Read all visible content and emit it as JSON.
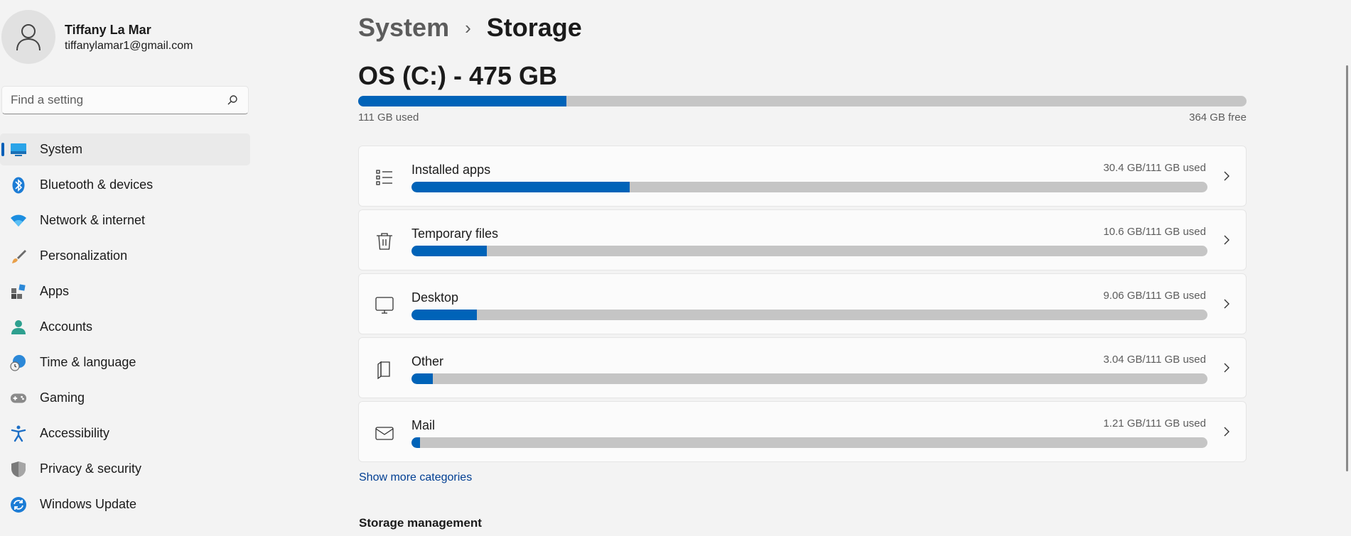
{
  "profile": {
    "name": "Tiffany La Mar",
    "email": "tiffanylamar1@gmail.com"
  },
  "search": {
    "placeholder": "Find a setting"
  },
  "sidebar": {
    "items": [
      {
        "label": "System",
        "icon": "system-icon",
        "active": true
      },
      {
        "label": "Bluetooth & devices",
        "icon": "bluetooth-icon"
      },
      {
        "label": "Network & internet",
        "icon": "wifi-icon"
      },
      {
        "label": "Personalization",
        "icon": "brush-icon"
      },
      {
        "label": "Apps",
        "icon": "apps-icon"
      },
      {
        "label": "Accounts",
        "icon": "account-icon"
      },
      {
        "label": "Time & language",
        "icon": "globe-clock-icon"
      },
      {
        "label": "Gaming",
        "icon": "gamepad-icon"
      },
      {
        "label": "Accessibility",
        "icon": "accessibility-icon"
      },
      {
        "label": "Privacy & security",
        "icon": "shield-icon"
      },
      {
        "label": "Windows Update",
        "icon": "update-icon"
      }
    ]
  },
  "breadcrumb": {
    "parent": "System",
    "separator": "›",
    "current": "Storage"
  },
  "drive": {
    "title": "OS (C:) - 475 GB",
    "used_label": "111 GB used",
    "free_label": "364 GB free",
    "used_fraction": 0.234
  },
  "categories": [
    {
      "label": "Installed apps",
      "usage": "30.4 GB/111 GB used",
      "fraction": 0.274,
      "icon": "list-icon"
    },
    {
      "label": "Temporary files",
      "usage": "10.6 GB/111 GB used",
      "fraction": 0.095,
      "icon": "trash-icon"
    },
    {
      "label": "Desktop",
      "usage": "9.06 GB/111 GB used",
      "fraction": 0.082,
      "icon": "monitor-icon"
    },
    {
      "label": "Other",
      "usage": "3.04 GB/111 GB used",
      "fraction": 0.027,
      "icon": "document-icon"
    },
    {
      "label": "Mail",
      "usage": "1.21 GB/111 GB used",
      "fraction": 0.011,
      "icon": "mail-icon"
    }
  ],
  "show_more_label": "Show more categories",
  "storage_management_title": "Storage management",
  "colors": {
    "accent": "#0063b8",
    "bar_track": "#c5c5c5",
    "link": "#003e92"
  }
}
